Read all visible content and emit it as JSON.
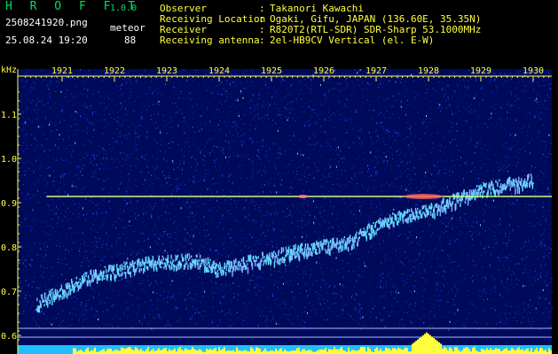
{
  "header": {
    "app_title": "H R O F F T",
    "version": "1.0.0",
    "filename": "2508241920.png",
    "mode": "meteor",
    "datetime": "25.08.24 19:20",
    "count": "88"
  },
  "info": [
    {
      "label": "Observer",
      "sep": ":",
      "value": "Takanori Kawachi"
    },
    {
      "label": "Receiving Location",
      "sep": ":",
      "value": "Ogaki, Gifu, JAPAN (136.60E, 35.35N)"
    },
    {
      "label": "Receiver",
      "sep": ":",
      "value": "R820T2(RTL-SDR) SDR-Sharp 53.1000MHz"
    },
    {
      "label": "Receiving antenna",
      "sep": ":",
      "value": "2el-HB9CV Vertical (el. E-W)"
    }
  ],
  "chart_data": {
    "type": "heatmap",
    "ylabel": "kHz",
    "y_ticks": [
      "1.1",
      "1.0",
      "0.9",
      "0.8",
      "0.7",
      "0.6"
    ],
    "x_ticks": [
      "1921",
      "1922",
      "1923",
      "1924",
      "1925",
      "1926",
      "1927",
      "1928",
      "1929",
      "1930"
    ],
    "ylim": [
      0.58,
      1.19
    ],
    "carrier_line_khz": 0.914,
    "drifting_trace": {
      "x": [
        "1920.5",
        "1921.5",
        "1922.5",
        "1923.5",
        "1924",
        "1925.5",
        "1926.5",
        "1927.2",
        "1928",
        "1929",
        "1930"
      ],
      "y_khz": [
        0.67,
        0.73,
        0.76,
        0.77,
        0.75,
        0.79,
        0.81,
        0.86,
        0.88,
        0.93,
        0.95
      ]
    },
    "colors": {
      "background": "#000a5a",
      "noise": "#1e4cff",
      "signal": "#60e0ff",
      "hot": "#ffff40",
      "carrier": "#c8ff80",
      "axis": "#ffff40"
    }
  }
}
